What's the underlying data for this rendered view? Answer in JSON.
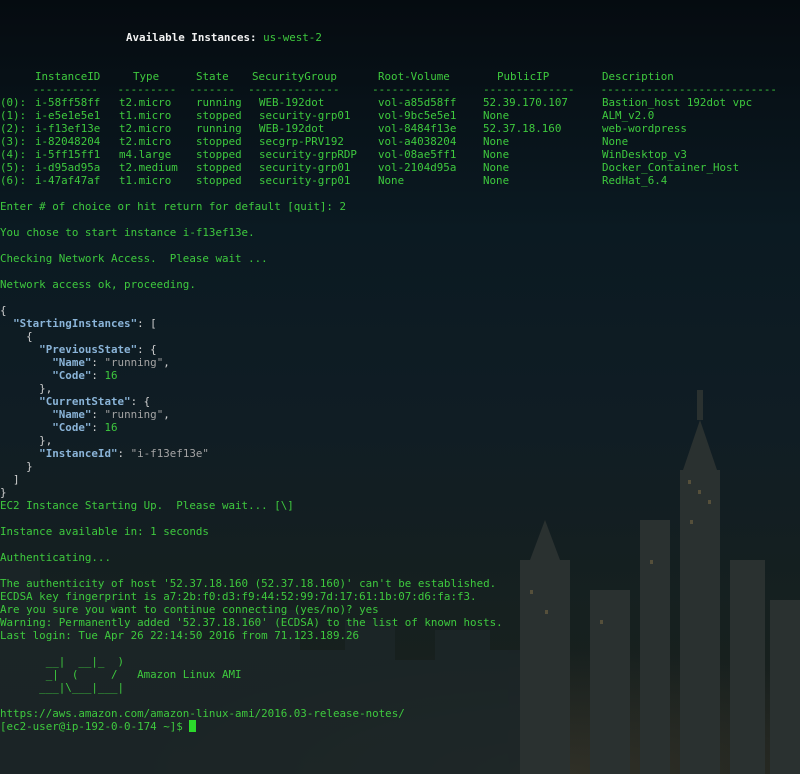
{
  "header": {
    "label": "Available Instances:",
    "region": "us-west-2"
  },
  "table": {
    "headers": [
      "InstanceID",
      "Type",
      "State",
      "SecurityGroup",
      "Root-Volume",
      "PublicIP",
      "Description"
    ],
    "underline": "     ----------   ---------  -------  --------------     ------------     --------------    ---------------------------",
    "rows": [
      {
        "idx": "(0):",
        "id": "i-58ff58ff",
        "type": "t2.micro",
        "state": "running",
        "sg": "WEB-192dot",
        "vol": "vol-a85d58ff",
        "ip": "52.39.170.107",
        "desc": "Bastion_host 192dot vpc"
      },
      {
        "idx": "(1):",
        "id": "i-e5e1e5e1",
        "type": "t1.micro",
        "state": "stopped",
        "sg": "security-grp01",
        "vol": "vol-9bc5e5e1",
        "ip": "None",
        "desc": "ALM_v2.0"
      },
      {
        "idx": "(2):",
        "id": "i-f13ef13e",
        "type": "t2.micro",
        "state": "running",
        "sg": "WEB-192dot",
        "vol": "vol-8484f13e",
        "ip": "52.37.18.160",
        "desc": "web-wordpress"
      },
      {
        "idx": "(3):",
        "id": "i-82048204",
        "type": "t2.micro",
        "state": "stopped",
        "sg": "secgrp-PRV192",
        "vol": "vol-a4038204",
        "ip": "None",
        "desc": "None"
      },
      {
        "idx": "(4):",
        "id": "i-5ff15ff1",
        "type": "m4.large",
        "state": "stopped",
        "sg": "security-grpRDP",
        "vol": "vol-08ae5ff1",
        "ip": "None",
        "desc": "WinDesktop_v3"
      },
      {
        "idx": "(5):",
        "id": "i-d95ad95a",
        "type": "t2.medium",
        "state": "stopped",
        "sg": "security-grp01",
        "vol": "vol-2104d95a",
        "ip": "None",
        "desc": "Docker_Container_Host"
      },
      {
        "idx": "(6):",
        "id": "i-47af47af",
        "type": "t1.micro",
        "state": "stopped",
        "sg": "security-grp01",
        "vol": "None",
        "ip": "None",
        "desc": "RedHat_6.4"
      }
    ]
  },
  "session": {
    "choice_prompt": "Enter # of choice or hit return for default [quit]: 2",
    "chose": "You chose to start instance i-f13ef13e.",
    "checking": "Checking Network Access.  Please wait ...",
    "network_ok": "Network access ok, proceeding.",
    "starting_up": "EC2 Instance Starting Up.  Please wait... [\\]",
    "available_in": "Instance available in: 1 seconds",
    "authenticating": "Authenticating...",
    "ssh_warning": [
      "The authenticity of host '52.37.18.160 (52.37.18.160)' can't be established.",
      "ECDSA key fingerprint is a7:2b:f0:d3:f9:44:52:99:7d:17:61:1b:07:d6:fa:f3.",
      "Are you sure you want to continue connecting (yes/no)? yes",
      "Warning: Permanently added '52.37.18.160' (ECDSA) to the list of known hosts.",
      "Last login: Tue Apr 26 22:14:50 2016 from 71.123.189.26"
    ],
    "banner": [
      "       __|  __|_  )",
      "       _|  (     /   Amazon Linux AMI",
      "      ___|\\___|___|"
    ],
    "release_notes": "https://aws.amazon.com/amazon-linux-ami/2016.03-release-notes/",
    "prompt": "[ec2-user@ip-192-0-0-174 ~]$ "
  },
  "json_response": {
    "root_key": "StartingInstances",
    "prev_key": "PreviousState",
    "curr_key": "CurrentState",
    "name_key": "Name",
    "code_key": "Code",
    "id_key": "InstanceId",
    "prev_name": "running",
    "prev_code": "16",
    "curr_name": "running",
    "curr_code": "16",
    "instance_id": "i-f13ef13e"
  },
  "colors": {
    "text": "#3ec93e",
    "keys": "#8ab4d8",
    "strings": "#a4a4a4",
    "cursor": "#2bd92b"
  }
}
